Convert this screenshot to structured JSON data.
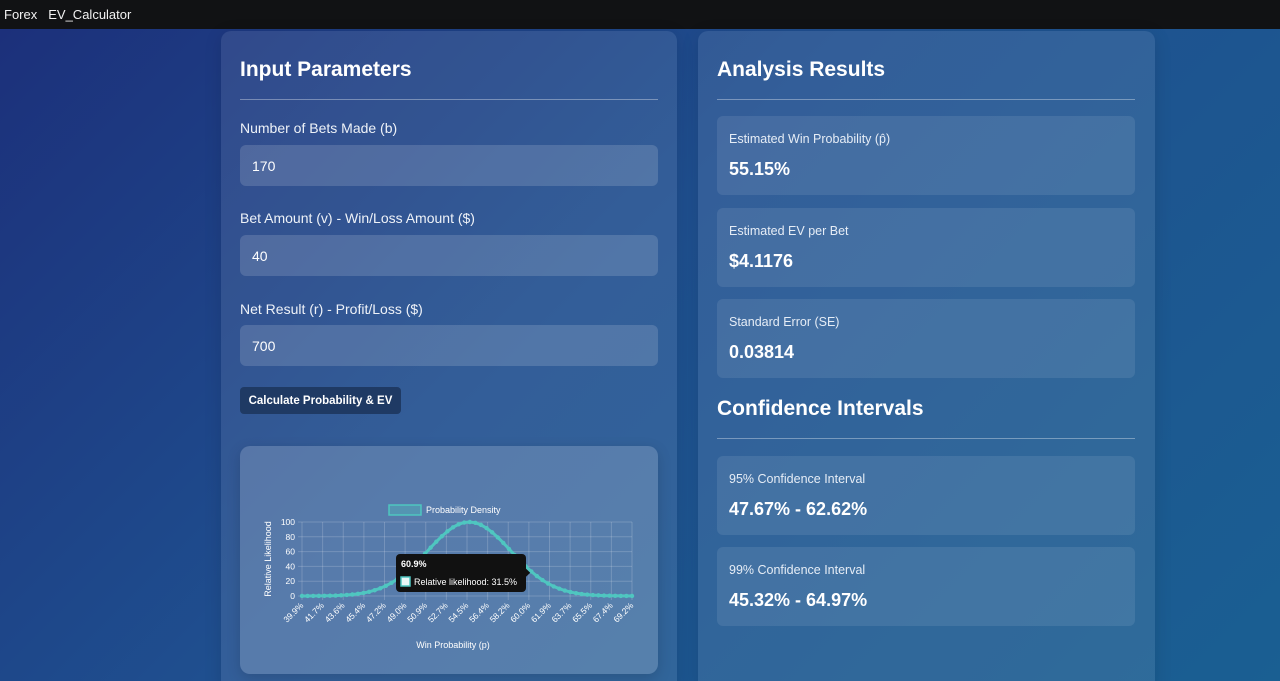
{
  "topbar": {
    "items": [
      "Forex",
      "EV_Calculator"
    ]
  },
  "input_panel": {
    "title": "Input Parameters",
    "fields": [
      {
        "label": "Number of Bets Made (b)",
        "value": "170"
      },
      {
        "label": "Bet Amount (v) - Win/Loss Amount ($)",
        "value": "40"
      },
      {
        "label": "Net Result (r) - Profit/Loss ($)",
        "value": "700"
      }
    ],
    "button_label": "Calculate Probability & EV"
  },
  "results_panel": {
    "title": "Analysis Results",
    "results": [
      {
        "label": "Estimated Win Probability (p̂)",
        "value": "55.15%"
      },
      {
        "label": "Estimated EV per Bet",
        "value": "$4.1176"
      },
      {
        "label": "Standard Error (SE)",
        "value": "0.03814"
      }
    ],
    "ci_title": "Confidence Intervals",
    "intervals": [
      {
        "label": "95% Confidence Interval",
        "value": "47.67% - 62.62%"
      },
      {
        "label": "99% Confidence Interval",
        "value": "45.32% - 64.97%"
      }
    ]
  },
  "chart_data": {
    "type": "line",
    "legend": "Probability Density",
    "xlabel": "Win Probability (p)",
    "ylabel": "Relative Likelihood",
    "x_tick_labels": [
      "39.9%",
      "41.7%",
      "43.6%",
      "45.4%",
      "47.2%",
      "49.0%",
      "50.9%",
      "52.7%",
      "54.5%",
      "56.4%",
      "58.2%",
      "60.0%",
      "61.9%",
      "63.7%",
      "65.5%",
      "67.4%",
      "69.2%"
    ],
    "y_ticks": [
      0,
      20,
      40,
      60,
      80,
      100
    ],
    "ylim": [
      0,
      100
    ],
    "xlim": [
      39.9,
      70.0
    ],
    "mean": 55.15,
    "sd": 3.814,
    "points": 60,
    "tooltip": {
      "title": "60.9%",
      "text": "Relative likelihood: 31.5%",
      "x": 60.9,
      "y": 31.5
    },
    "line_color": "#4fc6c0"
  }
}
